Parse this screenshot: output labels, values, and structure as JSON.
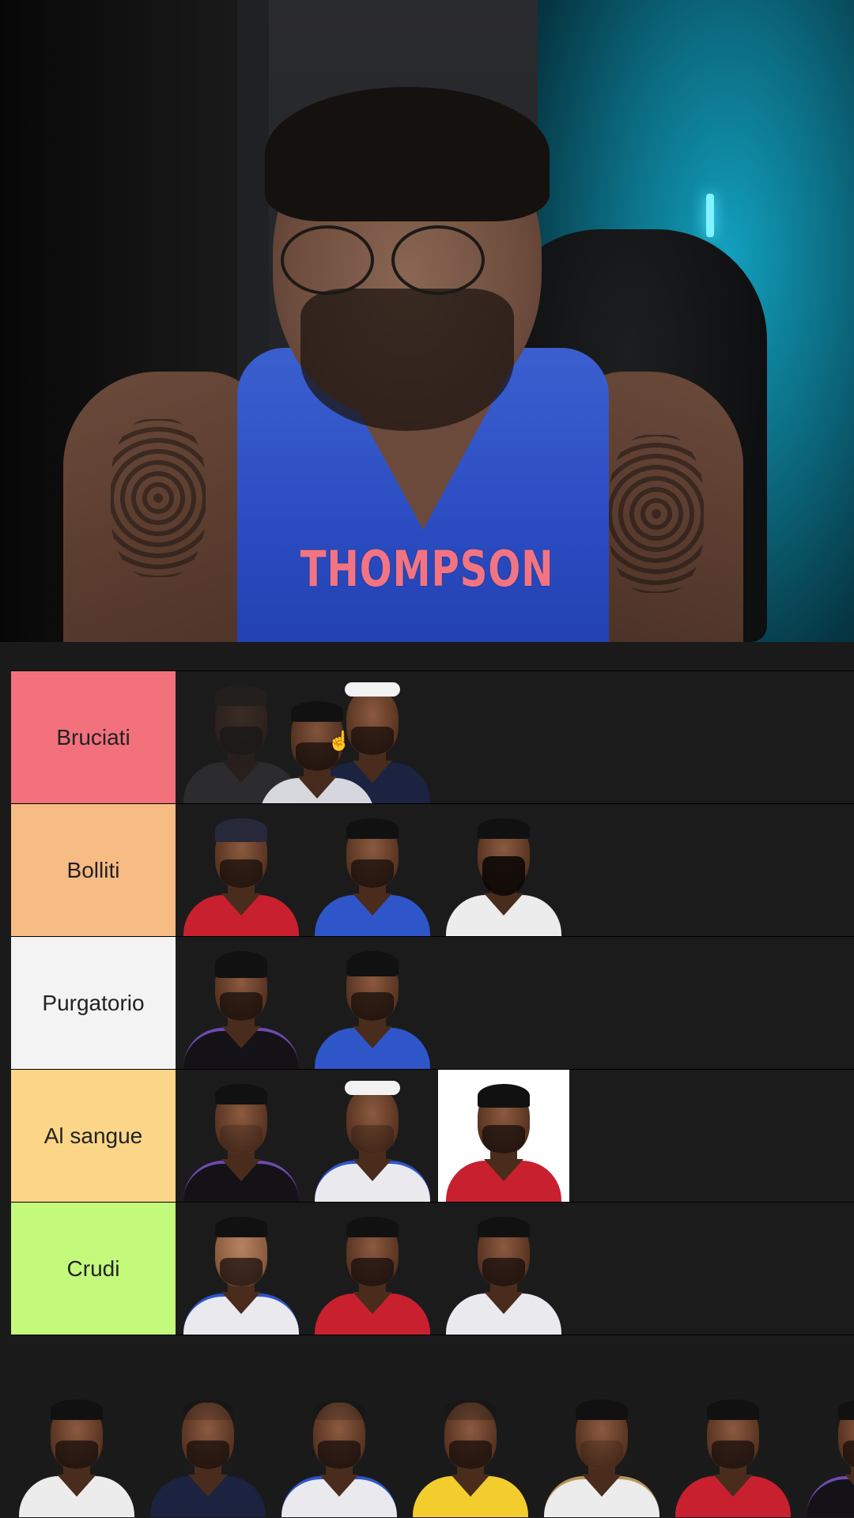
{
  "caption": "THOMPSON",
  "tiers": [
    {
      "label": "Bruciati",
      "color": "#f2717d"
    },
    {
      "label": "Bolliti",
      "color": "#f7bb84"
    },
    {
      "label": "Purgatorio",
      "color": "#f3f3f3"
    },
    {
      "label": "Al sangue",
      "color": "#fbd688"
    },
    {
      "label": "Crudi",
      "color": "#c3fa7c"
    }
  ],
  "colors": {
    "background": "#1a1a1b",
    "caption": "#f27483",
    "jersey_blue": "#2f56c9",
    "jersey_red": "#c8202f",
    "jersey_white": "#e9e9ee",
    "jersey_black": "#141216",
    "jersey_navy": "#1c2340",
    "jersey_yellow": "#f3cd2d"
  },
  "icons": [
    "hand-pointer-icon"
  ]
}
